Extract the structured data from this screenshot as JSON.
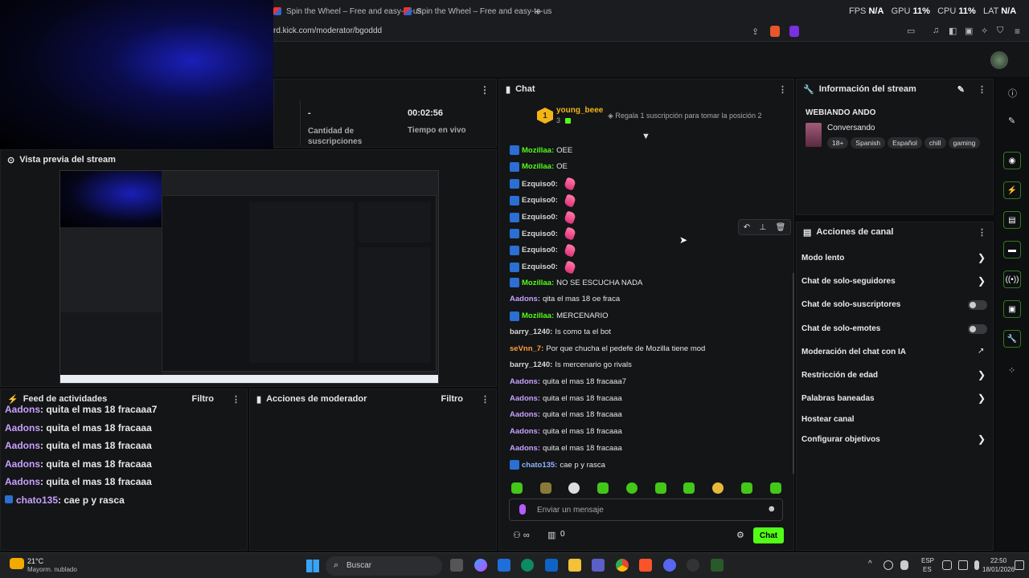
{
  "browser": {
    "tabs": [
      {
        "title": "Spin the Wheel – Free and easy-to-us"
      },
      {
        "title": "Spin the Wheel – Free and easy-to-us"
      }
    ],
    "new_tab": "+",
    "url": "rd.kick.com/moderator/bgoddd",
    "perf": {
      "fps_label": "FPS",
      "fps": "N/A",
      "gpu_label": "GPU",
      "gpu": "11%",
      "cpu_label": "CPU",
      "cpu": "11%",
      "lat_label": "LAT",
      "lat": "N/A"
    }
  },
  "stats": {
    "subs_value": "-",
    "subs_label": "Cantidad de suscripciones",
    "live_value": "00:02:56",
    "live_label": "Tiempo en vivo"
  },
  "preview": {
    "title": "Vista previa del stream"
  },
  "activity": {
    "title": "Feed de actividades",
    "filter": "Filtro",
    "items": [
      {
        "user": "Aadons",
        "text": ": quita el mas 18 fracaaa7"
      },
      {
        "user": "Aadons",
        "text": ": quita el mas 18 fracaaa"
      },
      {
        "user": "Aadons",
        "text": ": quita el mas 18 fracaaa"
      },
      {
        "user": "Aadons",
        "text": ": quita el mas 18 fracaaa"
      },
      {
        "user": "Aadons",
        "text": ": quita el mas 18 fracaaa"
      },
      {
        "user": "chato135",
        "text": ": cae p y rasca"
      }
    ]
  },
  "modactions": {
    "title": "Acciones de moderador",
    "filter": "Filtro"
  },
  "chat": {
    "title": "Chat",
    "pinned_rank": "1",
    "pinned_user": "young_beee",
    "pinned_count": "3",
    "pinned_cta": "Regala 1 suscripción para tomar la posición 2",
    "messages": [
      {
        "user": "Mozillaa:",
        "text": "OEE",
        "style": "green",
        "badge": true
      },
      {
        "user": "Mozillaa:",
        "text": "OE",
        "style": "green",
        "badge": true
      },
      {
        "user": "Ezquiso0:",
        "text": "",
        "style": "light",
        "badge": true,
        "emote": true
      },
      {
        "user": "Ezquiso0:",
        "text": "",
        "style": "light",
        "badge": true,
        "emote": true
      },
      {
        "user": "Ezquiso0:",
        "text": "",
        "style": "light",
        "badge": true,
        "emote": true
      },
      {
        "user": "Ezquiso0:",
        "text": "",
        "style": "light",
        "badge": true,
        "emote": true
      },
      {
        "user": "Ezquiso0:",
        "text": "",
        "style": "light",
        "badge": true,
        "emote": true
      },
      {
        "user": "Ezquiso0:",
        "text": "",
        "style": "light",
        "badge": true,
        "emote": true
      },
      {
        "user": "Mozillaa:",
        "text": "NO SE ESCUCHA NADA",
        "style": "green",
        "badge": true
      },
      {
        "user": "Aadons:",
        "text": "qita el mas 18 oe fraca",
        "style": "purple",
        "badge": false
      },
      {
        "user": "Mozillaa:",
        "text": "MERCENARIO",
        "style": "green",
        "badge": true
      },
      {
        "user": "barry_1240:",
        "text": "Is como ta el bot",
        "style": "light",
        "badge": false
      },
      {
        "user": "seVnn_7:",
        "text": "Por que chucha el pedefe de Mozilla tiene mod",
        "style": "orange",
        "badge": false
      },
      {
        "user": "barry_1240:",
        "text": "Is mercenario go rivals",
        "style": "light",
        "badge": false
      },
      {
        "user": "Aadons:",
        "text": "quita el mas 18 fracaaa7",
        "style": "purple",
        "badge": false
      },
      {
        "user": "Aadons:",
        "text": "quita el mas 18 fracaaa",
        "style": "purple",
        "badge": false
      },
      {
        "user": "Aadons:",
        "text": "quita el mas 18 fracaaa",
        "style": "purple",
        "badge": false
      },
      {
        "user": "Aadons:",
        "text": "quita el mas 18 fracaaa",
        "style": "purple",
        "badge": false
      },
      {
        "user": "Aadons:",
        "text": "quita el mas 18 fracaaa",
        "style": "purple",
        "badge": false
      },
      {
        "user": "chato135:",
        "text": "cae p y rasca",
        "style": "blue",
        "badge": true
      }
    ],
    "input_placeholder": "Enviar un mensaje",
    "points": "0",
    "send_label": "Chat"
  },
  "streaminfo": {
    "title": "Información del stream",
    "stream_title": "WEBIANDO ANDO",
    "category": "Conversando",
    "tags": [
      "18+",
      "Spanish",
      "Español",
      "chill",
      "gaming"
    ]
  },
  "channel": {
    "title": "Acciones de canal",
    "items": [
      {
        "label": "Modo lento",
        "control": "chevron"
      },
      {
        "label": "Chat de solo-seguidores",
        "control": "chevron"
      },
      {
        "label": "Chat de solo-suscriptores",
        "control": "toggle"
      },
      {
        "label": "Chat de solo-emotes",
        "control": "toggle"
      },
      {
        "label": "Moderación del chat con IA",
        "control": "external"
      },
      {
        "label": "Restricción de edad",
        "control": "chevron"
      },
      {
        "label": "Palabras baneadas",
        "control": "chevron"
      },
      {
        "label": "Hostear canal",
        "control": "none"
      },
      {
        "label": "Configurar objetivos",
        "control": "chevron"
      }
    ]
  },
  "taskbar": {
    "weather_temp": "21°C",
    "weather_desc": "Mayorm. nublado",
    "search_placeholder": "Buscar",
    "lang1": "ESP",
    "lang2": "ES",
    "time": "22:50",
    "date": "18/01/2026"
  },
  "colors": {
    "accent": "#53fc18",
    "bg": "#141517"
  }
}
